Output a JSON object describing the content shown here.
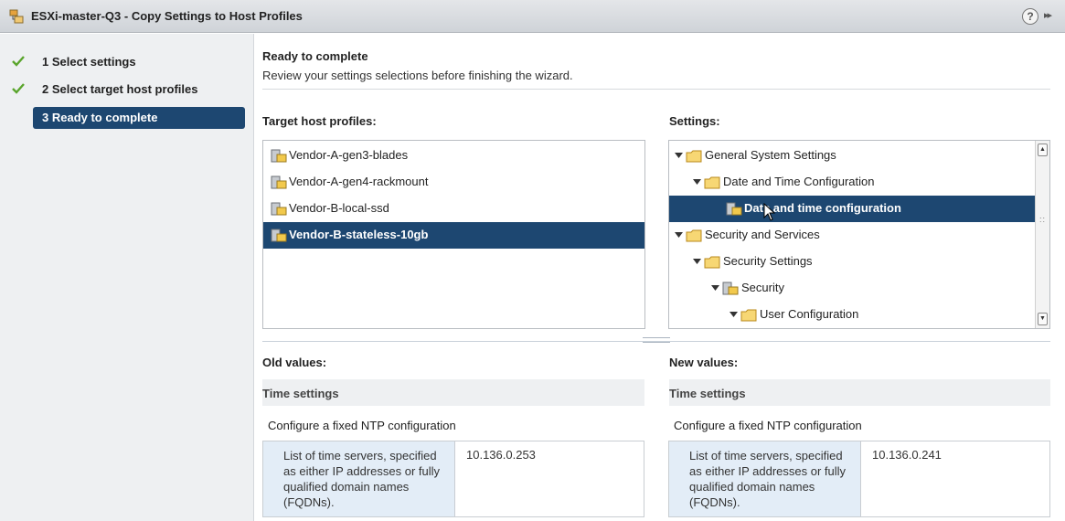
{
  "window": {
    "title": "ESXi-master-Q3 - Copy Settings to Host Profiles",
    "help_label": "?",
    "expand_label": "▸▸"
  },
  "steps": [
    {
      "label": "1  Select settings",
      "state": "done"
    },
    {
      "label": "2  Select target host profiles",
      "state": "done"
    },
    {
      "label": "3  Ready to complete",
      "state": "active"
    }
  ],
  "header": {
    "title": "Ready to complete",
    "subtitle": "Review your settings selections before finishing the wizard."
  },
  "target_profiles": {
    "label": "Target host profiles:",
    "items": [
      {
        "label": "Vendor-A-gen3-blades",
        "selected": false
      },
      {
        "label": "Vendor-A-gen4-rackmount",
        "selected": false
      },
      {
        "label": "Vendor-B-local-ssd",
        "selected": false
      },
      {
        "label": "Vendor-B-stateless-10gb",
        "selected": true
      }
    ]
  },
  "settings": {
    "label": "Settings:",
    "tree": [
      {
        "label": "General System Settings",
        "icon": "folder-icon",
        "level": 0,
        "selected": false
      },
      {
        "label": "Date and Time Configuration",
        "icon": "folder-icon",
        "level": 1,
        "selected": false
      },
      {
        "label": "Date and time configuration",
        "icon": "profile-icon",
        "level": 2,
        "selected": true
      },
      {
        "label": "Security and Services",
        "icon": "folder-icon",
        "level": 0,
        "selected": false
      },
      {
        "label": "Security Settings",
        "icon": "folder-icon",
        "level": 1,
        "selected": false
      },
      {
        "label": "Security",
        "icon": "profile-icon",
        "level": 2,
        "selected": false
      },
      {
        "label": "User Configuration",
        "icon": "folder-icon",
        "level": 3,
        "selected": false
      }
    ]
  },
  "old_values": {
    "label": "Old values:",
    "group": "Time settings",
    "config_title": "Configure a fixed NTP configuration",
    "key": "List of time servers, specified as either IP addresses or fully qualified domain names (FQDNs).",
    "value": "10.136.0.253"
  },
  "new_values": {
    "label": "New values:",
    "group": "Time settings",
    "config_title": "Configure a fixed NTP configuration",
    "key": "List of time servers, specified as either IP addresses or fully qualified domain names (FQDNs).",
    "value": "10.136.0.241"
  },
  "colors": {
    "selection": "#1d4771",
    "check": "#5aa52d",
    "folder": "#f2c94c",
    "sidebar_bg": "#eef0f2"
  }
}
